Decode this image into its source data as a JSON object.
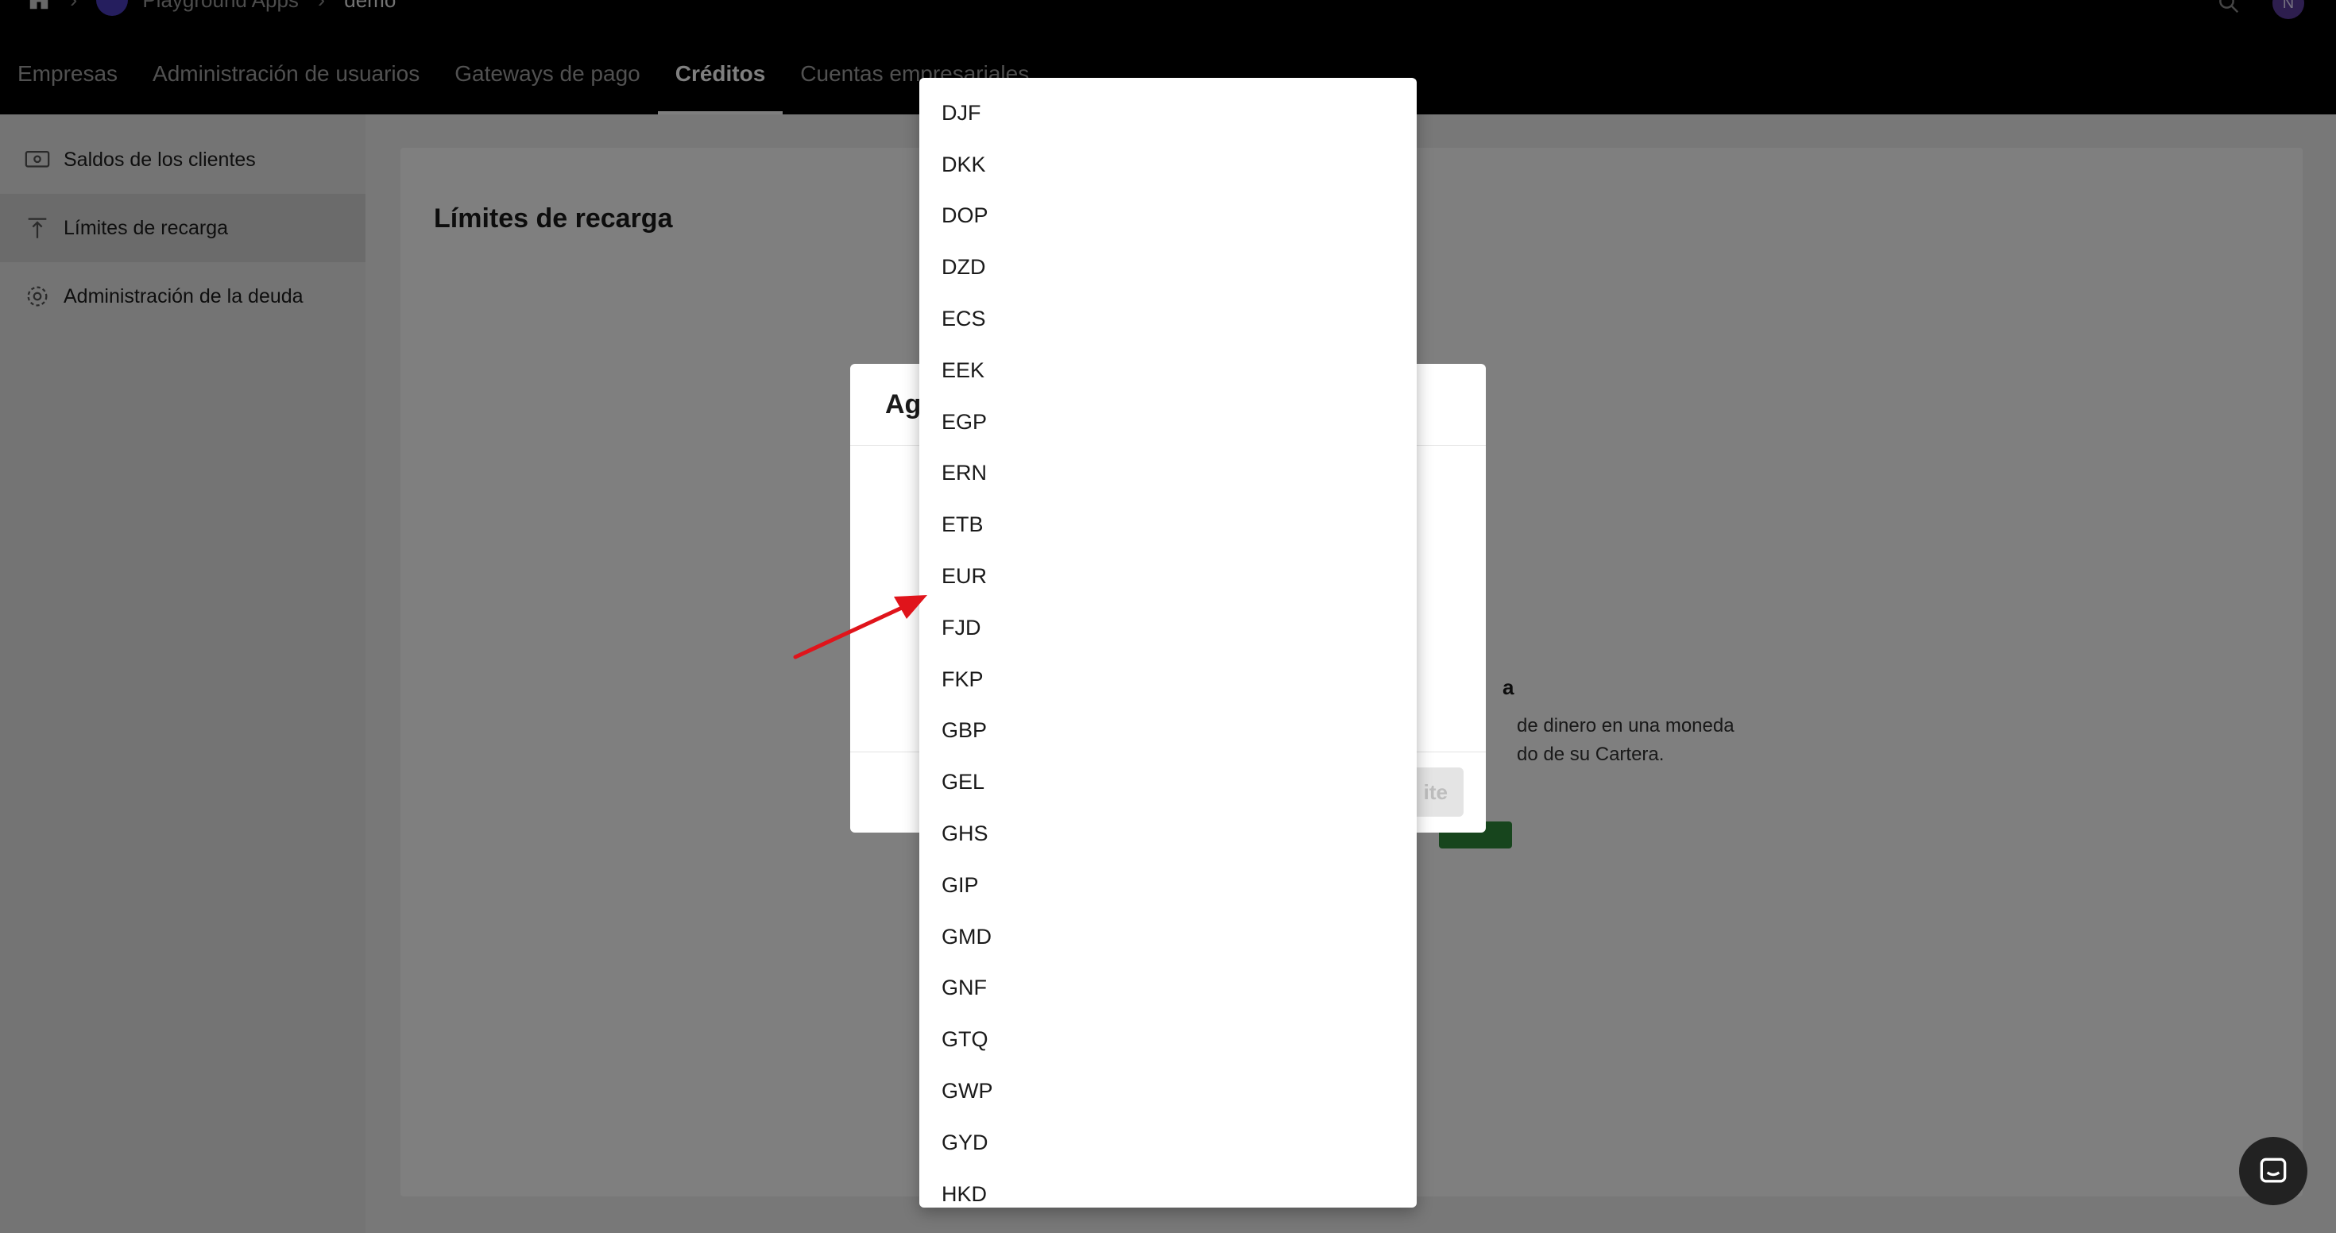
{
  "breadcrumb": {
    "app": "Playground Apps",
    "current": "demo"
  },
  "user": {
    "initial": "N"
  },
  "tabs": [
    {
      "label": "Empresas"
    },
    {
      "label": "Administración de usuarios"
    },
    {
      "label": "Gateways de pago"
    },
    {
      "label": "Créditos"
    },
    {
      "label": "Cuentas empresariales"
    }
  ],
  "sidebar": {
    "items": [
      {
        "label": "Saldos de los clientes",
        "icon": "money-icon"
      },
      {
        "label": "Límites de recarga",
        "icon": "upload-icon"
      },
      {
        "label": "Administración de la deuda",
        "icon": "gear-icon"
      }
    ]
  },
  "main": {
    "title": "Límites de recarga",
    "empty_title_fragment": "a",
    "empty_desc_line1": "de dinero en una moneda",
    "empty_desc_line2": "do de su Cartera."
  },
  "modal": {
    "title_fragment": "Ag",
    "button_fragment": "ite"
  },
  "dropdown": {
    "options": [
      "DJF",
      "DKK",
      "DOP",
      "DZD",
      "ECS",
      "EEK",
      "EGP",
      "ERN",
      "ETB",
      "EUR",
      "FJD",
      "FKP",
      "GBP",
      "GEL",
      "GHS",
      "GIP",
      "GMD",
      "GNF",
      "GTQ",
      "GWP",
      "GYD",
      "HKD"
    ],
    "highlighted": "EUR"
  },
  "colors": {
    "accent_green": "#2e8b3a",
    "arrow_red": "#e0141b",
    "avatar_purple": "#5a3d9c"
  }
}
